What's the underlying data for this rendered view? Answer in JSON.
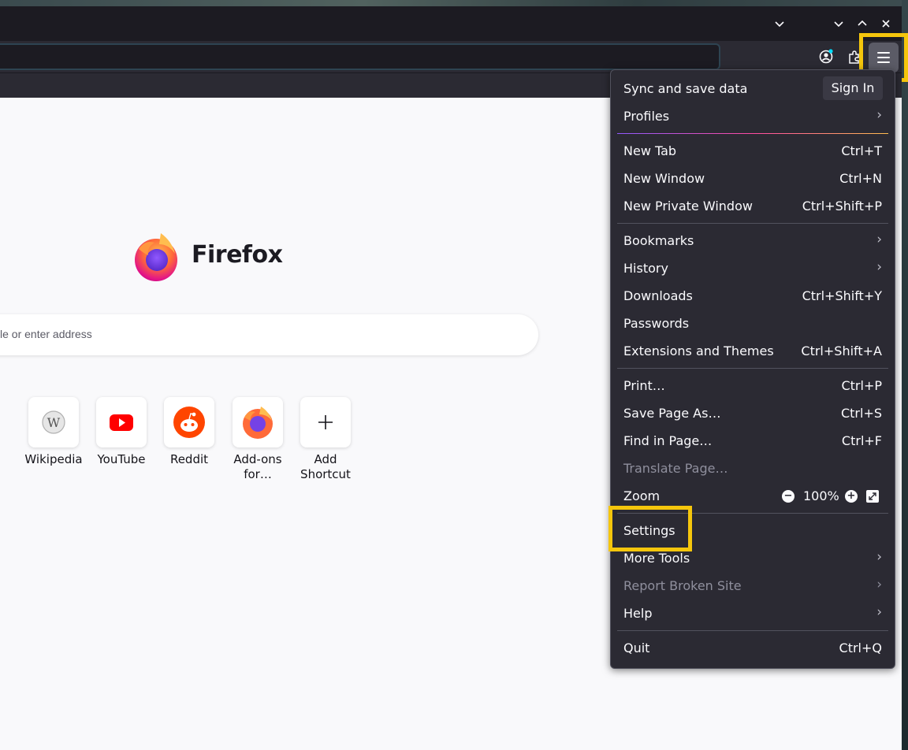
{
  "window": {
    "tab_list_icon": "chevron-down-icon",
    "minimize_icon": "minimize-icon",
    "maximize_icon": "maximize-icon",
    "close_icon": "close-icon"
  },
  "toolbar": {
    "account_icon": "account-icon",
    "extensions_icon": "extensions-icon",
    "menu_icon": "hamburger-menu-icon"
  },
  "newtab": {
    "brand": "Firefox",
    "search_placeholder": "le or enter address",
    "shortcuts": [
      {
        "label": "Wikipedia",
        "icon": "wikipedia-icon"
      },
      {
        "label": "YouTube",
        "icon": "youtube-icon"
      },
      {
        "label": "Reddit",
        "icon": "reddit-icon"
      },
      {
        "label": "Add-ons for…",
        "icon": "firefox-addons-icon"
      },
      {
        "label": "Add Shortcut",
        "icon": "plus-icon"
      }
    ]
  },
  "menu": {
    "sync_label": "Sync and save data",
    "sign_in": "Sign In",
    "profiles": "Profiles",
    "new_tab": {
      "label": "New Tab",
      "shortcut": "Ctrl+T"
    },
    "new_window": {
      "label": "New Window",
      "shortcut": "Ctrl+N"
    },
    "new_private_window": {
      "label": "New Private Window",
      "shortcut": "Ctrl+Shift+P"
    },
    "bookmarks": "Bookmarks",
    "history": "History",
    "downloads": {
      "label": "Downloads",
      "shortcut": "Ctrl+Shift+Y"
    },
    "passwords": "Passwords",
    "extensions": {
      "label": "Extensions and Themes",
      "shortcut": "Ctrl+Shift+A"
    },
    "print": {
      "label": "Print…",
      "shortcut": "Ctrl+P"
    },
    "save_page": {
      "label": "Save Page As…",
      "shortcut": "Ctrl+S"
    },
    "find": {
      "label": "Find in Page…",
      "shortcut": "Ctrl+F"
    },
    "translate": "Translate Page…",
    "zoom": {
      "label": "Zoom",
      "value": "100%"
    },
    "settings": "Settings",
    "more_tools": "More Tools",
    "report_broken": "Report Broken Site",
    "help": "Help",
    "quit": {
      "label": "Quit",
      "shortcut": "Ctrl+Q"
    }
  },
  "colors": {
    "highlight": "#f5c60c",
    "panel_bg": "#2b2a33",
    "titlebar_bg": "#1c1b22"
  }
}
